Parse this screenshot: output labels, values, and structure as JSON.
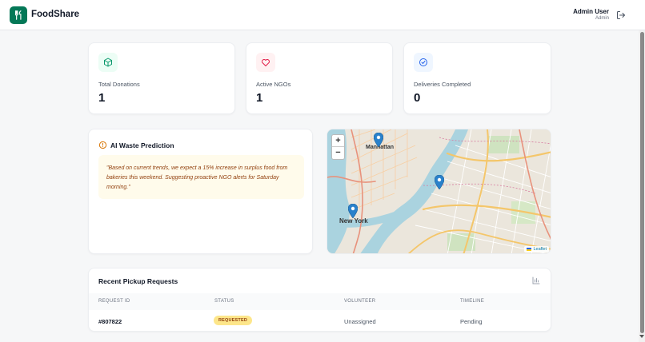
{
  "app": {
    "brand": "FoodShare"
  },
  "user": {
    "name": "Admin User",
    "role": "Admin"
  },
  "stats": [
    {
      "label": "Total Donations",
      "value": "1",
      "icon": "box-icon",
      "color": "#059669",
      "bg": "#ecfdf5"
    },
    {
      "label": "Active NGOs",
      "value": "1",
      "icon": "heart-icon",
      "color": "#e11d48",
      "bg": "#fff1f2"
    },
    {
      "label": "Deliveries Completed",
      "value": "0",
      "icon": "check-circle-icon",
      "color": "#2563eb",
      "bg": "#eff6ff"
    }
  ],
  "ai": {
    "title": "AI Waste Prediction",
    "text": "\"Based on current trends, we expect a 15% increase in surplus food from bakeries this weekend. Suggesting proactive NGO alerts for Saturday morning.\""
  },
  "map": {
    "zoom_in": "+",
    "zoom_out": "−",
    "attribution": "Leaflet",
    "labels": {
      "manhattan": "Manhattan",
      "new_york": "New York"
    }
  },
  "requests": {
    "title": "Recent Pickup Requests",
    "columns": [
      "REQUEST ID",
      "STATUS",
      "VOLUNTEER",
      "TIMELINE"
    ],
    "rows": [
      {
        "id": "#807822",
        "status": "REQUESTED",
        "volunteer": "Unassigned",
        "timeline": "Pending"
      }
    ]
  },
  "colors": {
    "brand": "#047857",
    "marker": "#2a81cb"
  }
}
